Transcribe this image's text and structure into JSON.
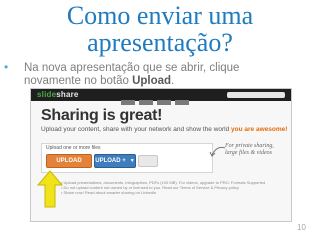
{
  "slide": {
    "title_line1": "Como enviar uma",
    "title_line2": "apresentação?",
    "bullet": "•",
    "body": "Na nova apresentação que se abrir, clique novamente no botão ",
    "body_bold": "Upload",
    "body_end": ".",
    "page_number": "10"
  },
  "screenshot": {
    "logo_prefix": "slide",
    "logo_suffix": "share",
    "heading": "Sharing is great!",
    "subheading": "Upload your content, share with your network and show the world ",
    "subheading_bold": "you are awesome!",
    "upload_label": "Upload one or more files",
    "upload_button": "UPLOAD",
    "upload_plus_button": "UPLOAD +",
    "private_note": "For private sharing, large files & videos",
    "notes": [
      "• Upload presentations, documents, infographics, PDFs (100 MB). For videos, upgrade to PRO. Formats Supported",
      "• Do not upload content not owned by or licensed to you. Read our Terms of Service & Privacy policy",
      "• Share now! Read about smarter sharing on LinkedIn"
    ]
  },
  "colors": {
    "title": "#1e7bc0",
    "upload_orange": "#e5823a",
    "upload_blue": "#3f7dbd",
    "arrow_yellow": "#f2e21a"
  }
}
